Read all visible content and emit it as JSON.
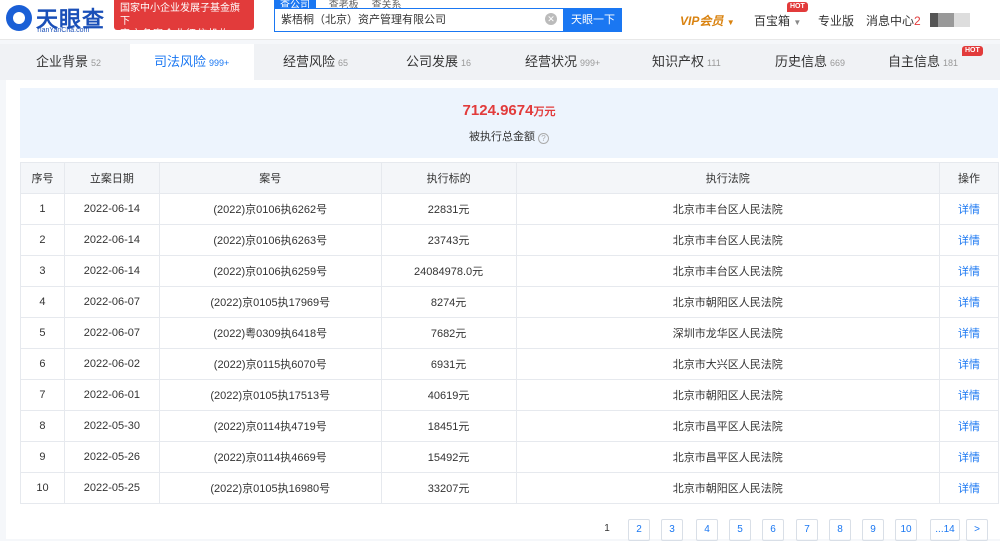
{
  "header": {
    "logo_text": "天眼查",
    "logo_sub": "TianYanCha.com",
    "banner_line1": "国家中小企业发展子基金旗下",
    "banner_line2": "官方备案企业征信机构",
    "search_tabs": [
      "查公司",
      "查老板",
      "查关系"
    ],
    "search_value": "紫梧桐（北京）资产管理有限公司",
    "search_button": "天眼一下",
    "vip": "VIP会员",
    "baibaoxiang": "百宝箱",
    "pro": "专业版",
    "messages": "消息中心",
    "message_count": "2",
    "hot": "HOT"
  },
  "tabs": [
    {
      "label": "企业背景",
      "count": "52"
    },
    {
      "label": "司法风险",
      "count": "999+"
    },
    {
      "label": "经营风险",
      "count": "65"
    },
    {
      "label": "公司发展",
      "count": "16"
    },
    {
      "label": "经营状况",
      "count": "999+"
    },
    {
      "label": "知识产权",
      "count": "111"
    },
    {
      "label": "历史信息",
      "count": "669"
    },
    {
      "label": "自主信息",
      "count": "181"
    }
  ],
  "summary": {
    "amount": "7124.9674",
    "unit": "万元",
    "label": "被执行总金额"
  },
  "table": {
    "headers": [
      "序号",
      "立案日期",
      "案号",
      "执行标的",
      "执行法院",
      "操作"
    ],
    "rows": [
      [
        "1",
        "2022-06-14",
        "(2022)京0106执6262号",
        "22831元",
        "北京市丰台区人民法院",
        "详情"
      ],
      [
        "2",
        "2022-06-14",
        "(2022)京0106执6263号",
        "23743元",
        "北京市丰台区人民法院",
        "详情"
      ],
      [
        "3",
        "2022-06-14",
        "(2022)京0106执6259号",
        "24084978.0元",
        "北京市丰台区人民法院",
        "详情"
      ],
      [
        "4",
        "2022-06-07",
        "(2022)京0105执17969号",
        "8274元",
        "北京市朝阳区人民法院",
        "详情"
      ],
      [
        "5",
        "2022-06-07",
        "(2022)粤0309执6418号",
        "7682元",
        "深圳市龙华区人民法院",
        "详情"
      ],
      [
        "6",
        "2022-06-02",
        "(2022)京0115执6070号",
        "6931元",
        "北京市大兴区人民法院",
        "详情"
      ],
      [
        "7",
        "2022-06-01",
        "(2022)京0105执17513号",
        "40619元",
        "北京市朝阳区人民法院",
        "详情"
      ],
      [
        "8",
        "2022-05-30",
        "(2022)京0114执4719号",
        "18451元",
        "北京市昌平区人民法院",
        "详情"
      ],
      [
        "9",
        "2022-05-26",
        "(2022)京0114执4669号",
        "15492元",
        "北京市昌平区人民法院",
        "详情"
      ],
      [
        "10",
        "2022-05-25",
        "(2022)京0105执16980号",
        "33207元",
        "北京市朝阳区人民法院",
        "详情"
      ]
    ]
  },
  "pager": {
    "pages": [
      "1",
      "2",
      "3",
      "4",
      "5",
      "6",
      "7",
      "8",
      "9",
      "10",
      "...14",
      ">"
    ],
    "current": "1"
  }
}
